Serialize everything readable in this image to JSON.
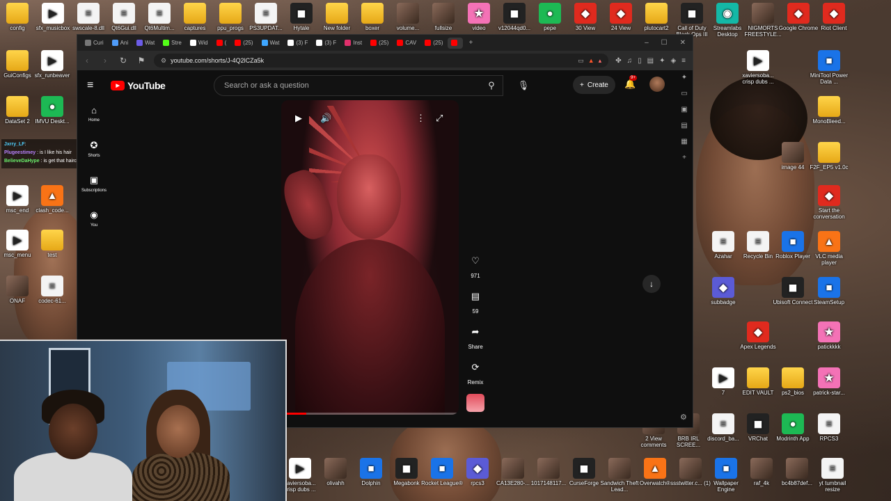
{
  "desktop": {
    "top_row": [
      {
        "label": "config",
        "icon": "folder-icon",
        "style": "folder"
      },
      {
        "label": "sfx_musicbox",
        "icon": "play-file-icon",
        "style": "play"
      },
      {
        "label": "swscale-8.dll",
        "icon": "dll-file-icon",
        "style": "file"
      },
      {
        "label": "Qt6Gui.dll",
        "icon": "dll-file-icon",
        "style": "file"
      },
      {
        "label": "Qt6Multim...",
        "icon": "dll-file-icon",
        "style": "file"
      },
      {
        "label": "captures",
        "icon": "folder-icon",
        "style": "folder"
      },
      {
        "label": "ppu_progs",
        "icon": "folder-icon",
        "style": "folder"
      },
      {
        "label": "PS3UPDAT...",
        "icon": "file-icon",
        "style": "file"
      },
      {
        "label": "Hytale",
        "icon": "hytale-icon",
        "style": "dark"
      },
      {
        "label": "New folder",
        "icon": "folder-icon",
        "style": "folder"
      },
      {
        "label": "boxer",
        "icon": "folder-icon",
        "style": "folder"
      },
      {
        "label": "volume...",
        "icon": "image-file-icon",
        "style": "photo"
      },
      {
        "label": "fullsize",
        "icon": "image-file-icon",
        "style": "photo"
      },
      {
        "label": "video",
        "icon": "video-file-icon",
        "style": "pink"
      },
      {
        "label": "v12044qd0...",
        "icon": "video-file-icon",
        "style": "dark"
      },
      {
        "label": "pepe",
        "icon": "image-file-icon",
        "style": "green"
      },
      {
        "label": "30 View",
        "icon": "brave-icon",
        "style": "red"
      },
      {
        "label": "24 View",
        "icon": "brave-icon",
        "style": "red"
      },
      {
        "label": "plutocart2",
        "icon": "folder-icon",
        "style": "folder"
      },
      {
        "label": "Call of Duty Black Ops III",
        "icon": "game-icon",
        "style": "dark"
      },
      {
        "label": "Streamlabs Desktop",
        "icon": "streamlabs-icon",
        "style": "teal"
      },
      {
        "label": "NIGMORTS FREESTYLE...",
        "icon": "video-file-icon",
        "style": "photo"
      },
      {
        "label": "Google Chrome",
        "icon": "chrome-icon",
        "style": "red"
      },
      {
        "label": "Riot Client",
        "icon": "riot-icon",
        "style": "red"
      }
    ],
    "left_col": [
      {
        "label": "GuiConfigs",
        "icon": "folder-icon",
        "style": "folder"
      },
      {
        "label": "sfx_runbeaver",
        "icon": "play-file-icon",
        "style": "play"
      },
      {
        "label": "DataSet 2",
        "icon": "folder-icon",
        "style": "folder"
      },
      {
        "label": "IMVU Deskt...",
        "icon": "imvu-icon",
        "style": "green"
      },
      {
        "label": "msc_end",
        "icon": "play-file-icon",
        "style": "play"
      },
      {
        "label": "clash_code...",
        "icon": "file-icon",
        "style": "orange"
      },
      {
        "label": "msc_menu",
        "icon": "play-file-icon",
        "style": "play"
      },
      {
        "label": "test",
        "icon": "folder-icon",
        "style": "folder"
      },
      {
        "label": "ONAF",
        "icon": "game-icon",
        "style": "photo"
      },
      {
        "label": "codec-61...",
        "icon": "dll-file-icon",
        "style": "file"
      }
    ],
    "right_col": [
      {
        "label": "xaviersoba... crisp dubs ...",
        "icon": "play-file-icon",
        "style": "play"
      },
      {
        "label": "MiniTool Power Data ...",
        "icon": "minitool-icon",
        "style": "blue"
      },
      {
        "label": "MonoBleed...",
        "icon": "folder-icon",
        "style": "folder"
      },
      {
        "label": "image 44",
        "icon": "image-file-icon",
        "style": "photo"
      },
      {
        "label": "F2F_EP5 v1.0c",
        "icon": "folder-icon",
        "style": "folder"
      },
      {
        "label": "Start the conversation",
        "icon": "brave-icon",
        "style": "red"
      },
      {
        "label": "Azahar",
        "icon": "azahar-icon",
        "style": "file"
      },
      {
        "label": "Recycle Bin",
        "icon": "recycle-bin-icon",
        "style": "file"
      },
      {
        "label": "Roblox Player",
        "icon": "roblox-icon",
        "style": "blue"
      },
      {
        "label": "VLC media player",
        "icon": "vlc-icon",
        "style": "orange"
      },
      {
        "label": "subbadge",
        "icon": "image-file-icon",
        "style": "purple"
      },
      {
        "label": "Ubisoft Connect",
        "icon": "ubisoft-icon",
        "style": "dark"
      },
      {
        "label": "SteamSetup",
        "icon": "steam-icon",
        "style": "blue"
      },
      {
        "label": "Apex Legends",
        "icon": "apex-icon",
        "style": "red"
      },
      {
        "label": "patickkkk",
        "icon": "image-file-icon",
        "style": "pink"
      },
      {
        "label": "7",
        "icon": "play-file-icon",
        "style": "play"
      },
      {
        "label": "EDIT VAULT",
        "icon": "folder-icon",
        "style": "folder"
      },
      {
        "label": "ps2_bios",
        "icon": "folder-icon",
        "style": "folder"
      },
      {
        "label": "patrick-star...",
        "icon": "image-file-icon",
        "style": "pink"
      },
      {
        "label": "2 View comments",
        "icon": "image-file-icon",
        "style": "photo"
      },
      {
        "label": "BRB IRL SCREE...",
        "icon": "image-file-icon",
        "style": "photo"
      },
      {
        "label": "discord_ba...",
        "icon": "file-icon",
        "style": "file"
      },
      {
        "label": "VRChat",
        "icon": "vrchat-icon",
        "style": "dark"
      },
      {
        "label": "Modrinth App",
        "icon": "modrinth-icon",
        "style": "green"
      },
      {
        "label": "RPCS3",
        "icon": "file-icon",
        "style": "file"
      }
    ],
    "bottom_row": [
      {
        "label": "xaviersoba... crisp dubs ...",
        "icon": "play-file-icon",
        "style": "play"
      },
      {
        "label": "olivahh",
        "icon": "image-file-icon",
        "style": "photo"
      },
      {
        "label": "Dolphin",
        "icon": "dolphin-icon",
        "style": "blue"
      },
      {
        "label": "Megabonk",
        "icon": "megabonk-icon",
        "style": "dark"
      },
      {
        "label": "Rocket League®",
        "icon": "rocket-league-icon",
        "style": "blue"
      },
      {
        "label": "rpcs3",
        "icon": "rpcs3-icon",
        "style": "purple"
      },
      {
        "label": "CA13E280-...",
        "icon": "image-file-icon",
        "style": "photo"
      },
      {
        "label": "1017148117...",
        "icon": "image-file-icon",
        "style": "photo"
      },
      {
        "label": "CurseForge",
        "icon": "curseforge-icon",
        "style": "dark"
      },
      {
        "label": "Sandwich Theft Lead...",
        "icon": "game-icon",
        "style": "photo"
      },
      {
        "label": "Overwatch®",
        "icon": "overwatch-icon",
        "style": "orange"
      },
      {
        "label": "ssstwitter.c... (1)",
        "icon": "video-file-icon",
        "style": "photo"
      },
      {
        "label": "Wallpaper Engine",
        "icon": "wallpaper-engine-icon",
        "style": "blue"
      },
      {
        "label": "raf_4k",
        "icon": "image-file-icon",
        "style": "photo"
      },
      {
        "label": "bc4b87def...",
        "icon": "image-file-icon",
        "style": "photo"
      },
      {
        "label": "yt tumbnail resize",
        "icon": "image-file-icon",
        "style": "file"
      }
    ]
  },
  "browser": {
    "tabs": [
      {
        "label": "Curi",
        "color": "#777"
      },
      {
        "label": "Ani",
        "color": "#4f9cf9"
      },
      {
        "label": "Wat",
        "color": "#6c5ce7"
      },
      {
        "label": "Stre",
        "color": "#53fc18"
      },
      {
        "label": "Wid",
        "color": "#fff"
      },
      {
        "label": "(",
        "color": "#ff0000"
      },
      {
        "label": "(25)",
        "color": "#ff0000"
      },
      {
        "label": "Wat",
        "color": "#3ea6ff"
      },
      {
        "label": "(3) F",
        "color": "#fff"
      },
      {
        "label": "(3) F",
        "color": "#fff"
      },
      {
        "label": "Inst",
        "color": "#e1306c"
      },
      {
        "label": "(25)",
        "color": "#ff0000"
      },
      {
        "label": "CAV",
        "color": "#ff0000"
      },
      {
        "label": "(25)",
        "color": "#ff0000"
      },
      {
        "label": "",
        "color": "#ff0000"
      }
    ],
    "url": "youtube.com/shorts/J-4Q2lCZa5k",
    "window_controls": [
      "–",
      "☐",
      "✕"
    ]
  },
  "youtube": {
    "logo_text": "YouTube",
    "search_placeholder": "Search or ask a question",
    "create_label": "Create",
    "notifications_badge": "9+",
    "sidebar": [
      {
        "label": "Home",
        "icon": "home-icon",
        "glyph": "⌂"
      },
      {
        "label": "Shorts",
        "icon": "shorts-icon",
        "glyph": "✪"
      },
      {
        "label": "Subscriptions",
        "icon": "subscriptions-icon",
        "glyph": "▣"
      },
      {
        "label": "You",
        "icon": "you-icon",
        "glyph": "◉"
      }
    ],
    "shorts": {
      "like_count": "971",
      "comment_count": "59",
      "share_label": "Share",
      "remix_label": "Remix",
      "progress": 0.14
    }
  },
  "chat": {
    "messages": [
      {
        "user": "Jxrry_LF",
        "text": ""
      },
      {
        "user": "Plugeestimey",
        "text": "is I like his hair"
      },
      {
        "user": "BelieveDaHype",
        "text": "is get that haircut pr"
      }
    ]
  },
  "colors": {
    "yt_red": "#ff0000",
    "yt_bg": "#0f0f0f",
    "badge_red": "#cc0000"
  }
}
